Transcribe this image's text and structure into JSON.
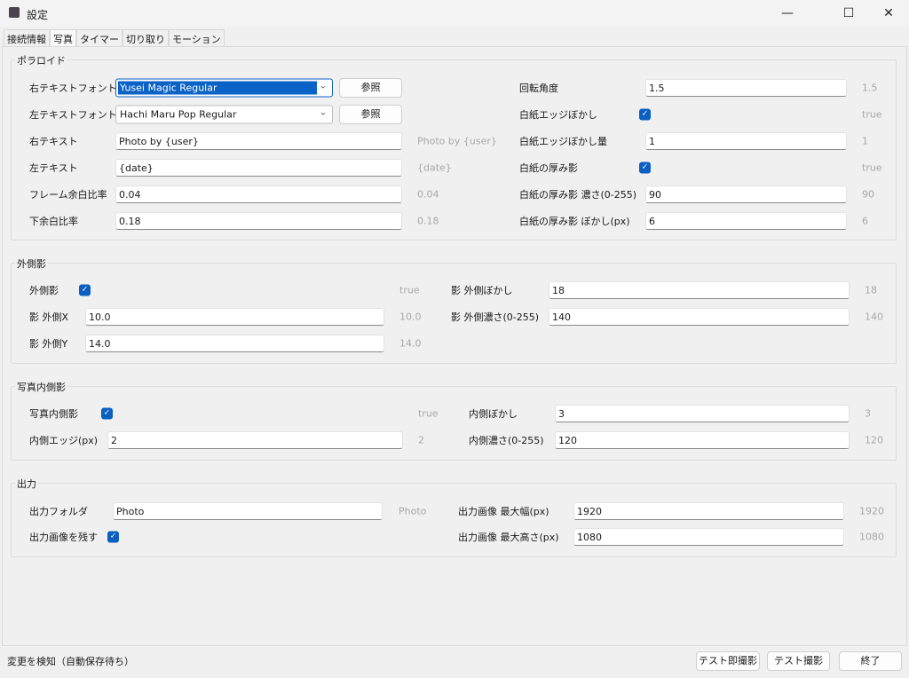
{
  "window": {
    "title": "設定",
    "minimize": "—",
    "maximize": "☐",
    "close": "✕"
  },
  "tabs": [
    "接続情報",
    "写真",
    "タイマー",
    "切り取り",
    "モーション"
  ],
  "polaroid": {
    "title": "ポラロイド",
    "right_font_label": "右テキストフォント",
    "right_font": "Yusei Magic Regular",
    "left_font_label": "左テキストフォント",
    "left_font": "Hachi Maru Pop Regular",
    "browse": "参照",
    "right_text_label": "右テキスト",
    "right_text": "Photo by {user}",
    "right_text_default": "Photo by {user}",
    "left_text_label": "左テキスト",
    "left_text": "{date}",
    "left_text_default": "{date}",
    "frame_margin_label": "フレーム余白比率",
    "frame_margin": "0.04",
    "frame_margin_default": "0.04",
    "bottom_margin_label": "下余白比率",
    "bottom_margin": "0.18",
    "bottom_margin_default": "0.18",
    "rotation_label": "回転角度",
    "rotation": "1.5",
    "rotation_default": "1.5",
    "edge_blur_label": "白紙エッジぼかし",
    "edge_blur_checked": true,
    "edge_blur_default": "true",
    "edge_blur_amount_label": "白紙エッジぼかし量",
    "edge_blur_amount": "1",
    "edge_blur_amount_default": "1",
    "thick_shadow_label": "白紙の厚み影",
    "thick_shadow_checked": true,
    "thick_shadow_default": "true",
    "thick_shadow_density_label": "白紙の厚み影 濃さ(0-255)",
    "thick_shadow_density": "90",
    "thick_shadow_density_default": "90",
    "thick_shadow_blur_label": "白紙の厚み影 ぼかし(px)",
    "thick_shadow_blur": "6",
    "thick_shadow_blur_default": "6"
  },
  "outer": {
    "title": "外側影",
    "enabled_label": "外側影",
    "enabled_checked": true,
    "enabled_default": "true",
    "x_label": "影 外側X",
    "x": "10.0",
    "x_default": "10.0",
    "y_label": "影 外側Y",
    "y": "14.0",
    "y_default": "14.0",
    "blur_label": "影 外側ぼかし",
    "blur": "18",
    "blur_default": "18",
    "density_label": "影 外側濃さ(0-255)",
    "density": "140",
    "density_default": "140"
  },
  "inner": {
    "title": "写真内側影",
    "enabled_label": "写真内側影",
    "enabled_checked": true,
    "enabled_default": "true",
    "edge_label": "内側エッジ(px)",
    "edge": "2",
    "edge_default": "2",
    "blur_label": "内側ぼかし",
    "blur": "3",
    "blur_default": "3",
    "density_label": "内側濃さ(0-255)",
    "density": "120",
    "density_default": "120"
  },
  "output": {
    "title": "出力",
    "folder_label": "出力フォルダ",
    "folder": "Photo",
    "folder_default": "Photo",
    "keep_label": "出力画像を残す",
    "keep_checked": true,
    "max_w_label": "出力画像 最大幅(px)",
    "max_w": "1920",
    "max_w_default": "1920",
    "max_h_label": "出力画像 最大高さ(px)",
    "max_h": "1080",
    "max_h_default": "1080"
  },
  "footer": {
    "status": "変更を検知（自動保存待ち）",
    "test_instant": "テスト即撮影",
    "test": "テスト撮影",
    "exit": "終了"
  },
  "check_glyph": "✓"
}
